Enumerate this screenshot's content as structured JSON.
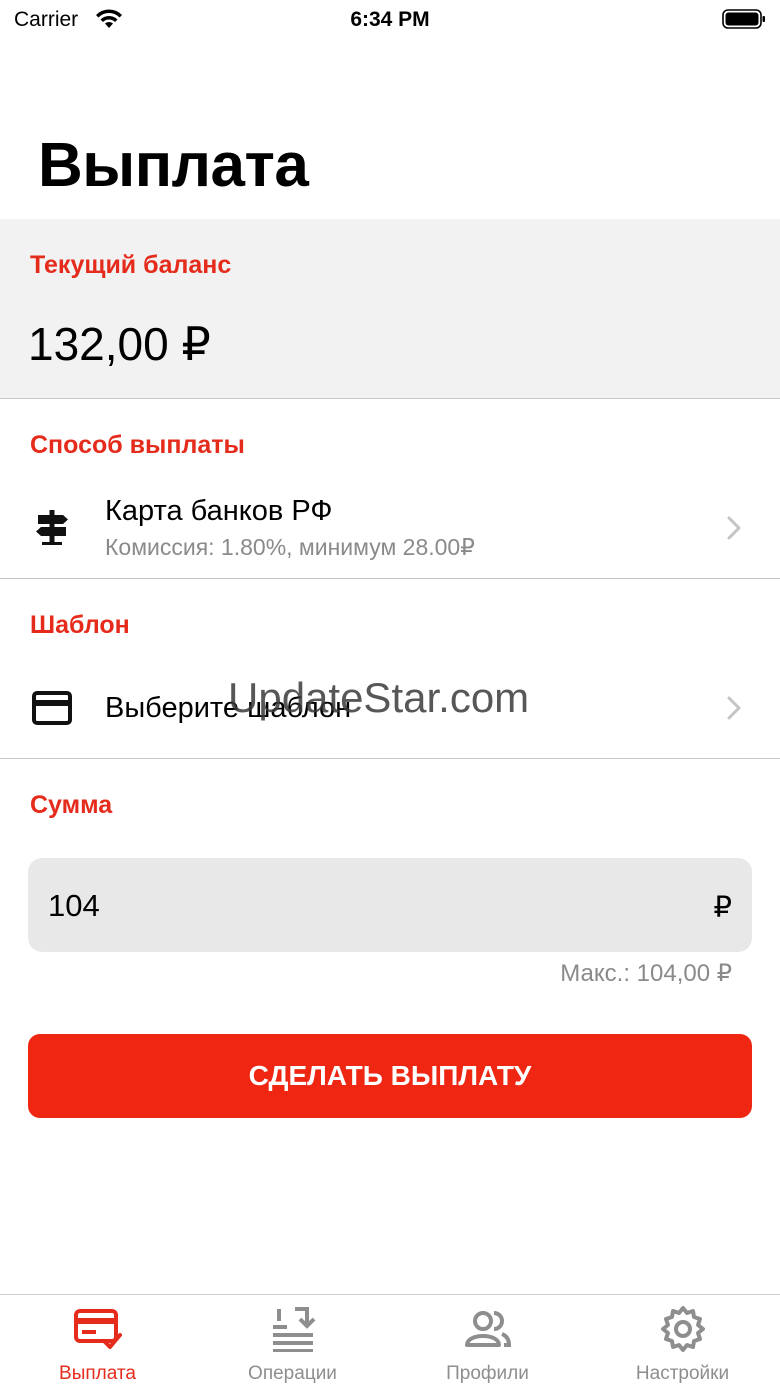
{
  "status_bar": {
    "carrier": "Carrier",
    "time": "6:34 PM"
  },
  "page": {
    "title": "Выплата"
  },
  "balance": {
    "label": "Текущий баланс",
    "value": "132,00 ₽"
  },
  "payout_method": {
    "label": "Способ выплаты",
    "title": "Карта банков РФ",
    "subtitle": "Комиссия: 1.80%, минимум 28.00₽",
    "icon": "signpost-icon"
  },
  "template": {
    "label": "Шаблон",
    "title": "Выберите шаблон",
    "icon": "card-icon"
  },
  "amount": {
    "label": "Сумма",
    "value": "104",
    "currency": "₽",
    "max": "Макс.: 104,00 ₽"
  },
  "submit": {
    "label": "СДЕЛАТЬ ВЫПЛАТУ"
  },
  "watermark": "UpdateStar.com",
  "tabs": [
    {
      "label": "Выплата",
      "icon": "payout-card-icon",
      "active": true
    },
    {
      "label": "Операции",
      "icon": "operations-icon",
      "active": false
    },
    {
      "label": "Профили",
      "icon": "profiles-icon",
      "active": false
    },
    {
      "label": "Настройки",
      "icon": "gear-icon",
      "active": false
    }
  ],
  "colors": {
    "accent": "#e52b1b",
    "button": "#ee2612",
    "inactive_tab": "#8e8e8e"
  }
}
